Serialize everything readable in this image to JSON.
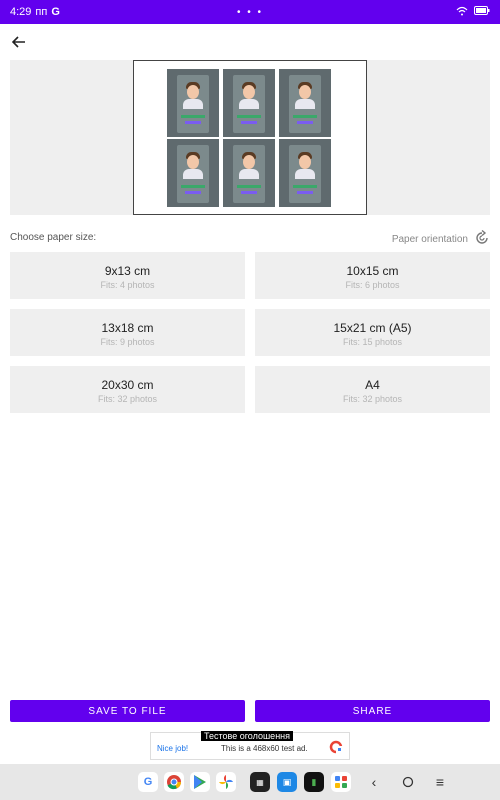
{
  "status_bar": {
    "time": "4:29",
    "extra": "пп",
    "center_dots": "• • •"
  },
  "paper": {
    "choose_label": "Choose paper size:",
    "orientation_label": "Paper orientation"
  },
  "sizes": [
    {
      "size": "9x13 cm",
      "fits": "Fits: 4 photos"
    },
    {
      "size": "10x15 cm",
      "fits": "Fits: 6 photos"
    },
    {
      "size": "13x18 cm",
      "fits": "Fits: 9 photos"
    },
    {
      "size": "15x21 cm (A5)",
      "fits": "Fits: 15 photos"
    },
    {
      "size": "20x30 cm",
      "fits": "Fits: 32 photos"
    },
    {
      "size": "A4",
      "fits": "Fits: 32 photos"
    }
  ],
  "actions": {
    "save_label": "SAVE TO FILE",
    "share_label": "SHARE"
  },
  "ad": {
    "title": "Тестове оголошення",
    "nice": "Nice job!",
    "text": "This is a 468x60 test ad."
  },
  "colors": {
    "accent": "#6200ee",
    "tile_bg": "#efefef"
  },
  "icons": {
    "back": "arrow-left-icon",
    "orientation": "rotate-icon",
    "wifi": "wifi-icon",
    "battery": "battery-icon"
  }
}
